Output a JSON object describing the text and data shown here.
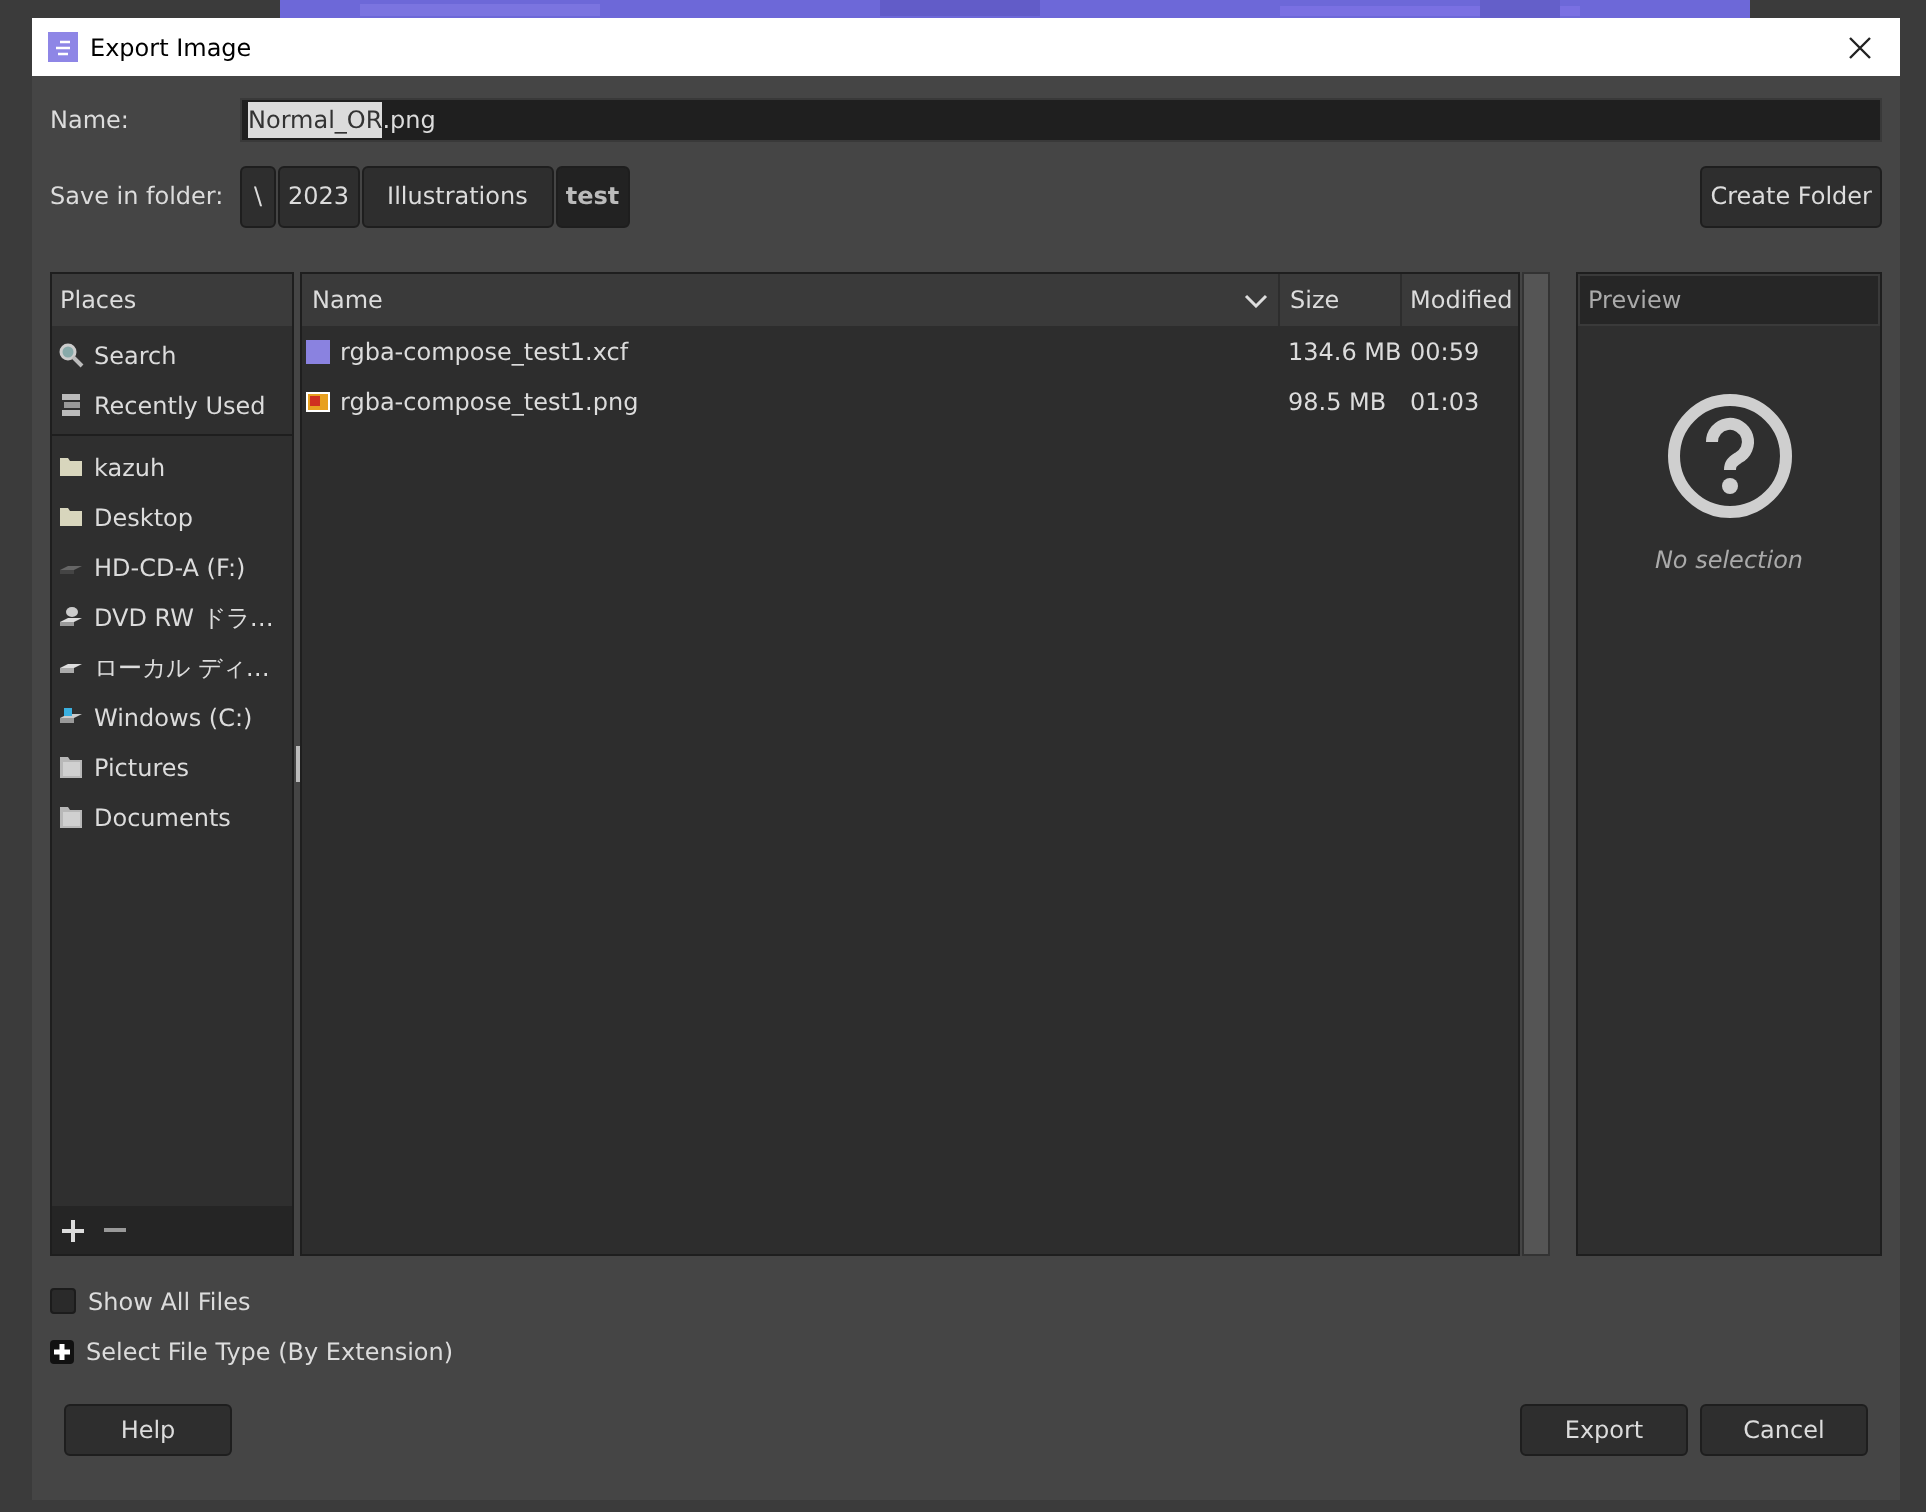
{
  "window": {
    "title": "Export Image"
  },
  "name_field": {
    "label": "Name:",
    "selected_text": "Normal_OR",
    "rest": ".png"
  },
  "folder": {
    "label": "Save in folder:",
    "path": [
      {
        "label": "\\",
        "selected": false
      },
      {
        "label": "2023",
        "selected": false
      },
      {
        "label": "Illustrations",
        "selected": false
      },
      {
        "label": "test",
        "selected": true
      }
    ],
    "create_button": "Create Folder"
  },
  "places": {
    "title": "Places",
    "sections": [
      [
        {
          "label": "Search",
          "kind": "search"
        },
        {
          "label": "Recently Used",
          "kind": "recent"
        }
      ],
      [
        {
          "label": "kazuh",
          "kind": "folder"
        },
        {
          "label": "Desktop",
          "kind": "folder"
        },
        {
          "label": "HD-CD-A (F:)",
          "kind": "drive"
        },
        {
          "label": "DVD RW ドラ…",
          "kind": "dvd"
        },
        {
          "label": "ローカル ディ…",
          "kind": "disk"
        },
        {
          "label": "Windows (C:)",
          "kind": "windows"
        },
        {
          "label": "Pictures",
          "kind": "plainfolder"
        },
        {
          "label": "Documents",
          "kind": "plainfolder"
        }
      ]
    ]
  },
  "files": {
    "columns": [
      "Name",
      "Size",
      "Modified"
    ],
    "rows": [
      {
        "name": "rgba-compose_test1.xcf",
        "kind": "xcf",
        "size": "134.6 MB",
        "modified": "00:59"
      },
      {
        "name": "rgba-compose_test1.png",
        "kind": "png",
        "size": "98.5 MB",
        "modified": "01:03"
      }
    ]
  },
  "preview": {
    "title": "Preview",
    "message": "No selection"
  },
  "options": [
    {
      "label": "Show All Files",
      "kind": "checkbox",
      "checked": false
    },
    {
      "label": "Select File Type (By Extension)",
      "kind": "expander",
      "expanded": false
    }
  ],
  "buttons": {
    "help": "Help",
    "export": "Export",
    "cancel": "Cancel"
  }
}
